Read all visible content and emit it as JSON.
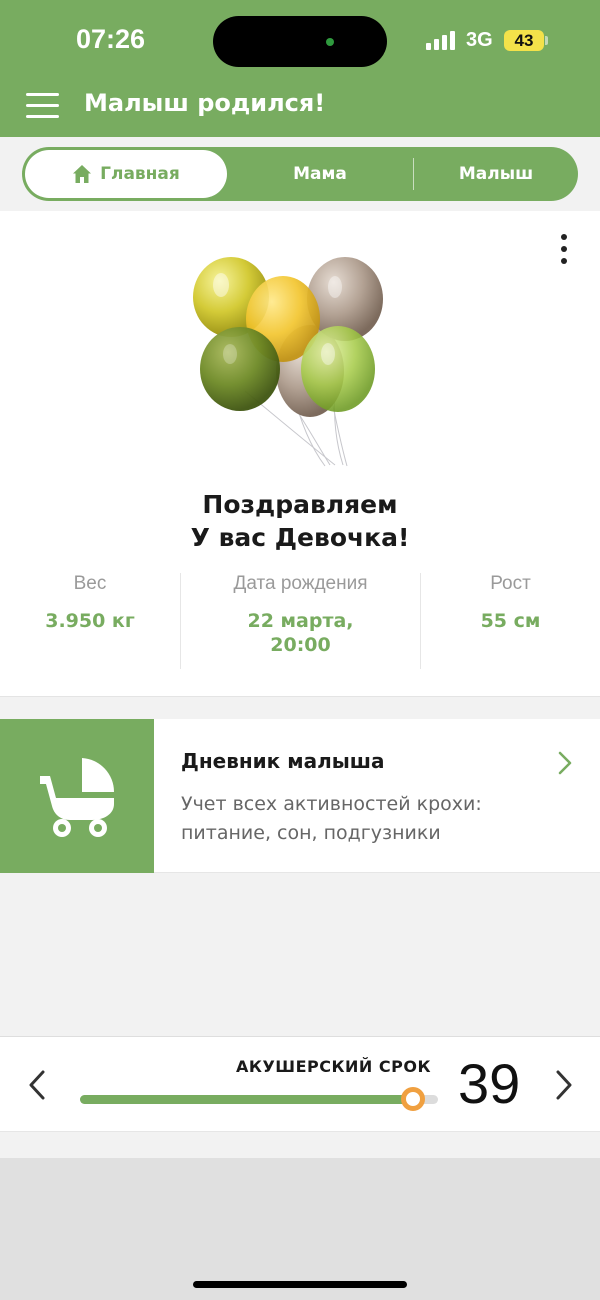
{
  "status_bar": {
    "time": "07:26",
    "network": "3G",
    "battery": "43"
  },
  "header": {
    "title": "Малыш родился!"
  },
  "tabs": [
    {
      "label": "Главная",
      "active": true
    },
    {
      "label": "Мама",
      "active": false
    },
    {
      "label": "Малыш",
      "active": false
    }
  ],
  "main": {
    "congrats_line1": "Поздравляем",
    "congrats_line2": "У вас Девочка!",
    "stats": {
      "weight": {
        "label": "Вес",
        "value": "3.950 кг"
      },
      "birth_date": {
        "label": "Дата рождения",
        "value_line1": "22 марта,",
        "value_line2": "20:00"
      },
      "height": {
        "label": "Рост",
        "value": "55 см"
      }
    }
  },
  "diary": {
    "title": "Дневник малыша",
    "description": "Учет всех активностей крохи: питание, сон, подгузники"
  },
  "term": {
    "label": "АКУШЕРСКИЙ СРОК",
    "value": "39",
    "progress": 0.93
  },
  "colors": {
    "accent": "#78ac60",
    "slider_thumb": "#f0a040",
    "battery": "#f4e24a"
  },
  "icons": [
    "menu-icon",
    "home-icon",
    "more-vert-icon",
    "balloons-image",
    "stroller-icon",
    "chevron-right-icon",
    "chevron-left-icon"
  ]
}
